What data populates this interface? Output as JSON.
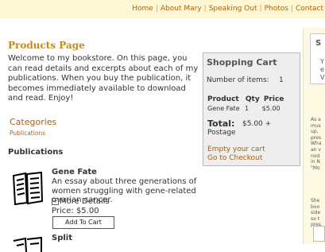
{
  "nav": {
    "items": [
      "Home",
      "About Mary",
      "Speaking Out",
      "Photos",
      "Contact"
    ],
    "separator": "|"
  },
  "main": {
    "title": "Products Page",
    "intro": "Welcome to my bookstore. On this page, you can read details and excerpts about each of my publications. When you buy the publication, it becomes immediately available to download and read. Enjoy!",
    "categories_heading": "Categories",
    "categories_link": "Publications",
    "publications_heading": "Publications"
  },
  "products": [
    {
      "title": "Gene Fate",
      "description": "An essay about three generations of women struggling with gene-related ovarian cancer.",
      "more": "More Details",
      "price": "Price: $5.00",
      "button": "Add To Cart"
    },
    {
      "title": "Split"
    }
  ],
  "cart": {
    "heading": "Shopping Cart",
    "items_label": "Number of items:",
    "items_count": "1",
    "col_product": "Product",
    "col_qty": "Qty",
    "col_price": "Price",
    "row": {
      "name": "Gene Fate",
      "qty": "1",
      "price": "$5.00"
    },
    "total_label": "Total:",
    "total_value": "$5.00 +",
    "postage": "Postage",
    "empty": "Empty your cart",
    "checkout": "Go to Checkout"
  },
  "right": {
    "box_title": "S",
    "box_l1": "Y",
    "box_l2": "e",
    "box_l3": "V",
    "text1": [
      "As a",
      "mus",
      "up,",
      "pres",
      "Wha",
      "an v",
      "nod",
      "in N",
      "\"Mo"
    ],
    "text2": [
      "She",
      "boo",
      "side",
      "so t",
      "pres"
    ]
  }
}
